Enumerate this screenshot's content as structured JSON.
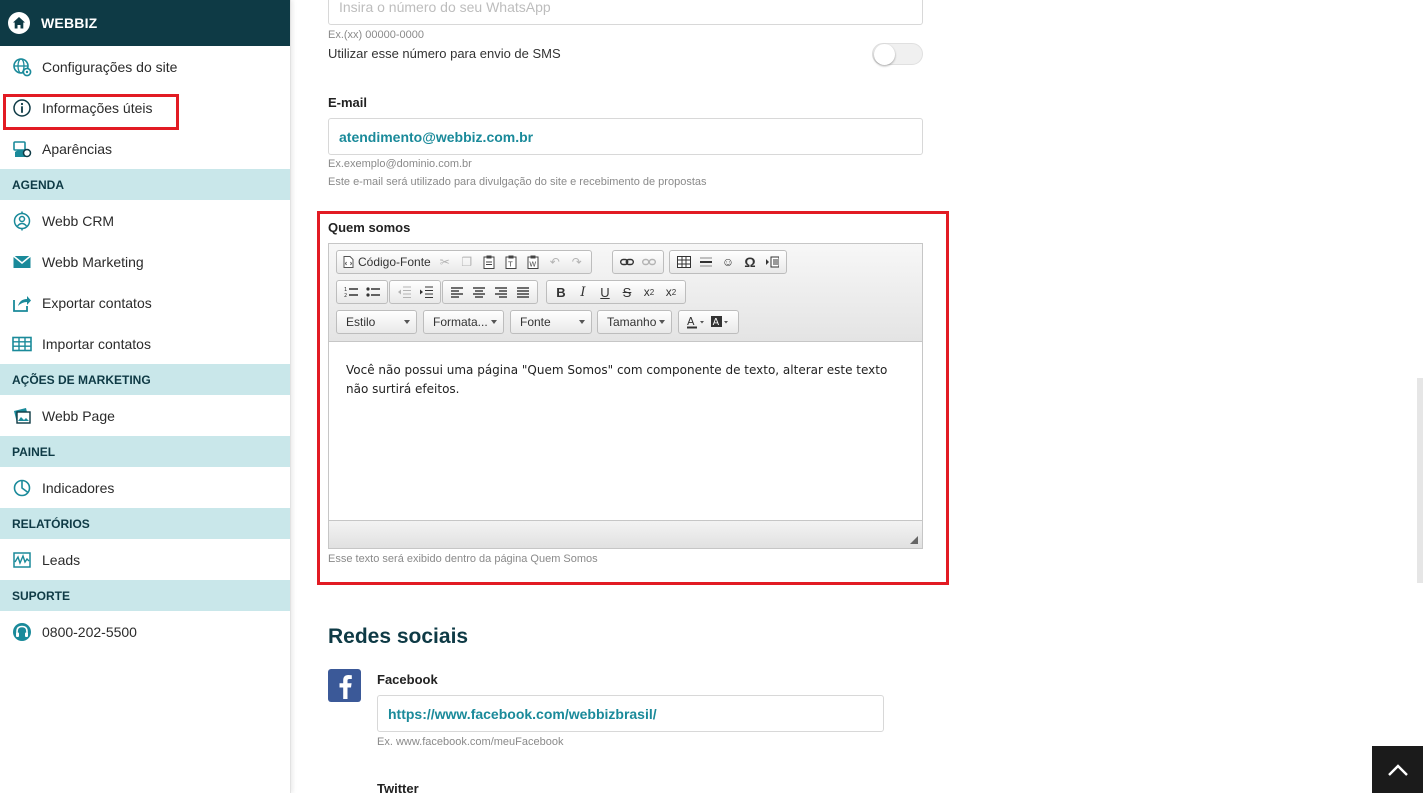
{
  "sidebar": {
    "brand": "WEBBIZ",
    "items_top": [
      {
        "label": "Configurações do site",
        "icon": "globe-gear-icon"
      },
      {
        "label": "Informações úteis",
        "icon": "info-icon"
      },
      {
        "label": "Aparências",
        "icon": "paint-icon"
      }
    ],
    "section_agenda": "AGENDA",
    "items_agenda": [
      {
        "label": "Webb CRM",
        "icon": "crm-icon"
      },
      {
        "label": "Webb Marketing",
        "icon": "mail-icon"
      },
      {
        "label": "Exportar contatos",
        "icon": "export-icon"
      },
      {
        "label": "Importar contatos",
        "icon": "table-icon"
      }
    ],
    "section_acoes": "AÇÕES DE MARKETING",
    "items_acoes": [
      {
        "label": "Webb Page",
        "icon": "webpage-icon"
      }
    ],
    "section_painel": "PAINEL",
    "items_painel": [
      {
        "label": "Indicadores",
        "icon": "pie-icon"
      }
    ],
    "section_relatorios": "RELATÓRIOS",
    "items_relatorios": [
      {
        "label": "Leads",
        "icon": "wave-chart-icon"
      }
    ],
    "section_suporte": "SUPORTE",
    "items_suporte": [
      {
        "label": "0800-202-5500",
        "icon": "headset-icon"
      }
    ]
  },
  "form": {
    "whatsapp_placeholder": "Insira o número do seu WhatsApp",
    "whatsapp_hint": "Ex.(xx) 00000-0000",
    "sms_toggle_label": "Utilizar esse número para envio de SMS",
    "sms_toggle_on": false,
    "email_label": "E-mail",
    "email_value": "atendimento@webbiz.com.br",
    "email_hint1": "Ex.exemplo@dominio.com.br",
    "email_hint2": "Este e-mail será utilizado para divulgação do site e recebimento de propostas",
    "about_label": "Quem somos",
    "about_hint": "Esse texto será exibido dentro da página Quem Somos"
  },
  "editor": {
    "source_button": "Código-Fonte",
    "style_combo": "Estilo",
    "format_combo": "Formata...",
    "font_combo": "Fonte",
    "size_combo": "Tamanho",
    "content": "Você não possui uma página \"Quem Somos\" com componente de texto, alterar este texto não surtirá efeitos."
  },
  "social": {
    "heading": "Redes sociais",
    "facebook_label": "Facebook",
    "facebook_value": "https://www.facebook.com/webbizbrasil/",
    "facebook_hint": "Ex. www.facebook.com/meuFacebook",
    "twitter_label": "Twitter"
  },
  "colors": {
    "brand_dark": "#0e3a45",
    "section_bg": "#c9e7ea",
    "accent_teal": "#1a8a9a",
    "highlight_red": "#e21b23",
    "facebook_blue": "#3b5998"
  }
}
